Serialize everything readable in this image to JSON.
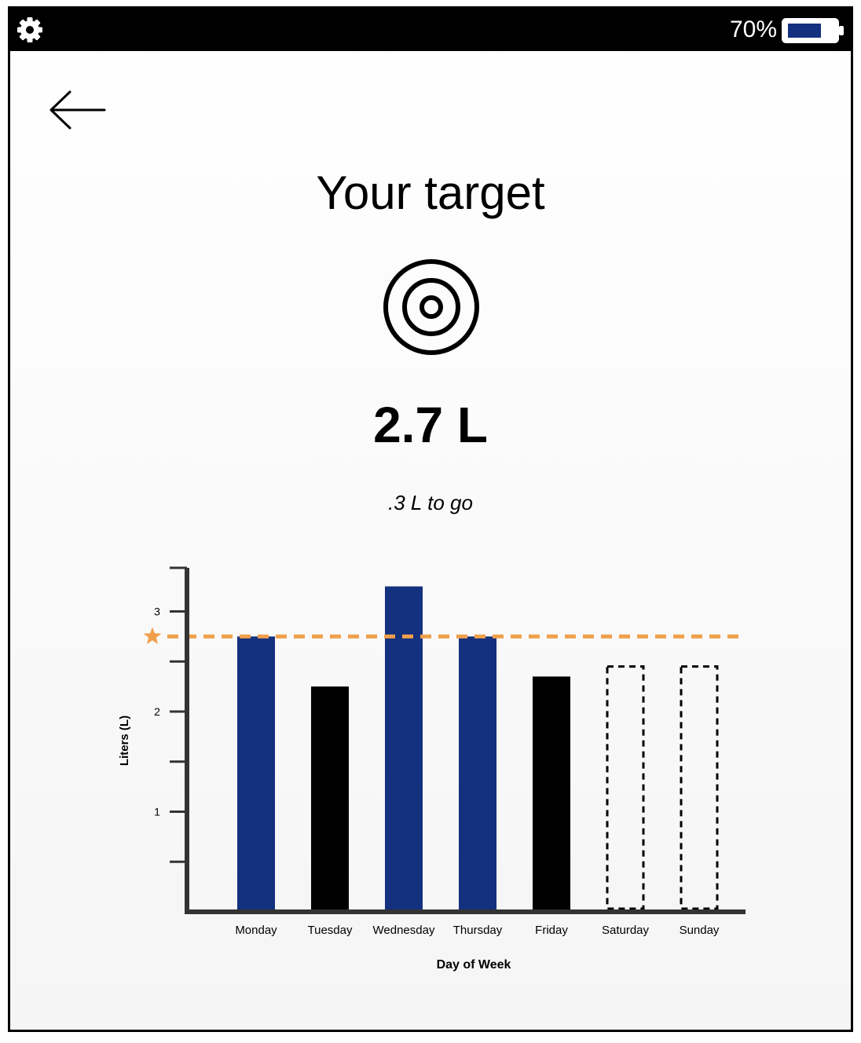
{
  "status_bar": {
    "settings_icon": "gear-icon",
    "battery_percent": "70%",
    "battery_level": 0.7,
    "battery_color": "#14317f"
  },
  "nav": {
    "back_icon": "arrow-left-icon"
  },
  "header": {
    "title": "Your target",
    "icon": "target-icon"
  },
  "summary": {
    "value": "2.7 L",
    "remaining": ".3 L to go"
  },
  "chart_data": {
    "type": "bar",
    "xlabel": "Day of Week",
    "ylabel": "Liters (L)",
    "ylim": [
      0,
      3.45
    ],
    "yticks": [
      "1",
      "2",
      "3"
    ],
    "target": 2.75,
    "target_marker": "star-icon",
    "categories": [
      "Monday",
      "Tuesday",
      "Wednesday",
      "Thursday",
      "Friday",
      "Saturday",
      "Sunday"
    ],
    "values": [
      2.75,
      2.25,
      3.25,
      2.75,
      2.35,
      2.45,
      2.45
    ],
    "status": [
      "met",
      "missed",
      "met",
      "met",
      "missed",
      "pending",
      "pending"
    ],
    "colors": {
      "met": "#14317f",
      "missed": "#000000",
      "pending": "#000000",
      "target": "#f0a04b"
    }
  }
}
